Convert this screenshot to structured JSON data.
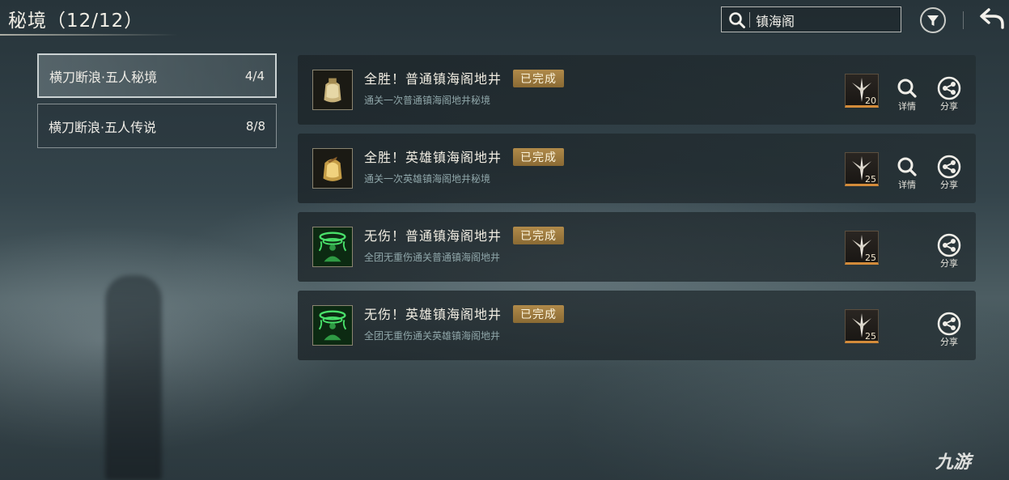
{
  "header": {
    "title": "秘境（12/12）",
    "search_value": "镇海阁",
    "search_icon": "magnifier",
    "filter_icon": "funnel",
    "back_icon": "return-arrow"
  },
  "sidebar": {
    "items": [
      {
        "label": "横刀断浪·五人秘境",
        "count": "4/4",
        "active": true
      },
      {
        "label": "横刀断浪·五人传说",
        "count": "8/8",
        "active": false
      }
    ]
  },
  "achievements": [
    {
      "title": "全胜！普通镇海阁地井",
      "badge": "已完成",
      "desc": "通关一次普通镇海阁地井秘境",
      "reward": "20",
      "detail_label": "详情",
      "share_label": "分享",
      "icon": "gold-bag"
    },
    {
      "title": "全胜！英雄镇海阁地井",
      "badge": "已完成",
      "desc": "通关一次英雄镇海阁地井秘境",
      "reward": "25",
      "detail_label": "详情",
      "share_label": "分享",
      "icon": "gold-bag-ornate"
    },
    {
      "title": "无伤！普通镇海阁地井",
      "badge": "已完成",
      "desc": "全团无重伤通关普通镇海阁地井",
      "reward": "25",
      "detail_label": null,
      "share_label": "分享",
      "icon": "green-meditation"
    },
    {
      "title": "无伤！英雄镇海阁地井",
      "badge": "已完成",
      "desc": "全团无重伤通关英雄镇海阁地井",
      "reward": "25",
      "detail_label": null,
      "share_label": "分享",
      "icon": "green-meditation"
    }
  ],
  "watermark": "九游",
  "colors": {
    "badge": "#9c7a3f",
    "reward_bar": "#d38b3a",
    "desc": "#8fa6a9"
  }
}
